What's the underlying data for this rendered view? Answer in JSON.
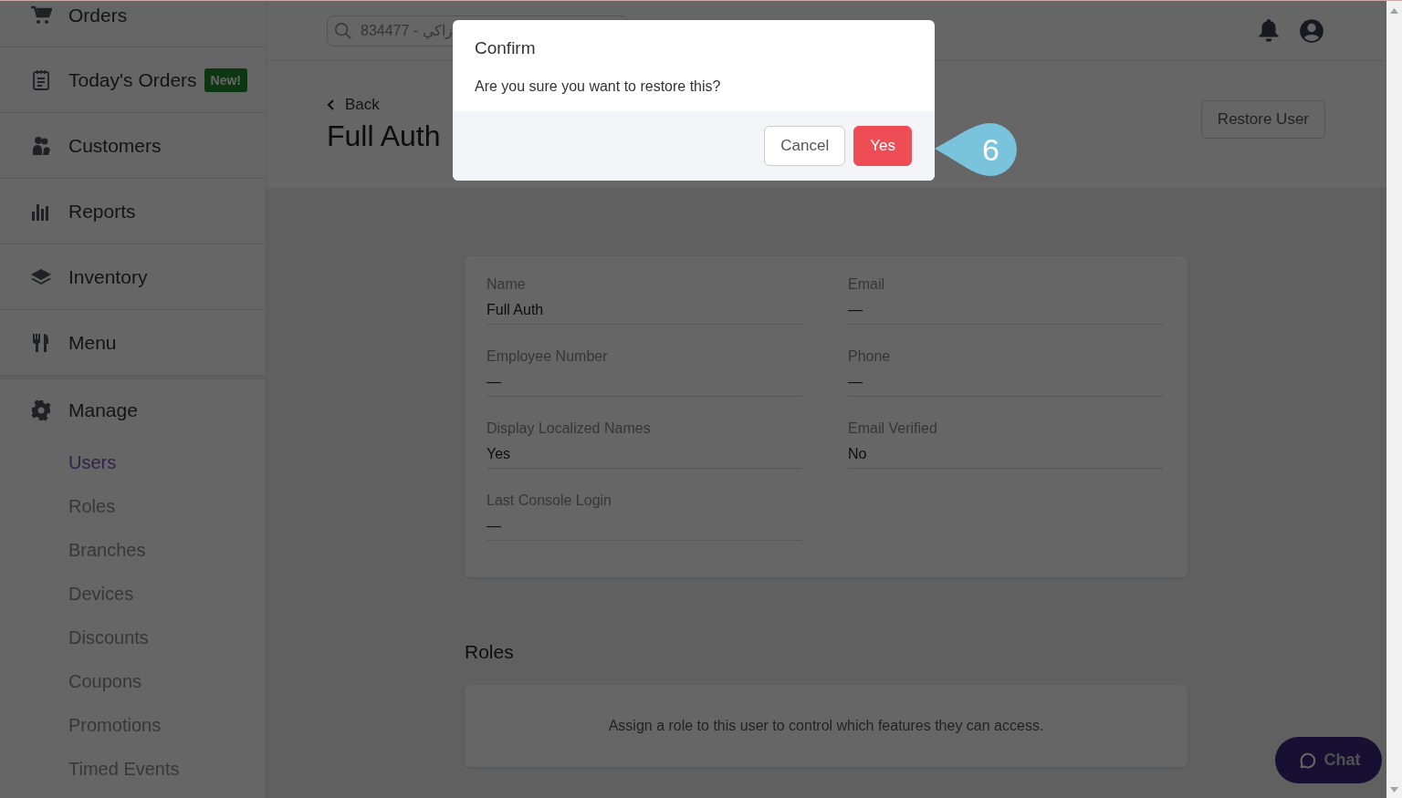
{
  "sidebar": {
    "items": [
      {
        "label": "Orders"
      },
      {
        "label": "Today's Orders",
        "badge": "New!"
      },
      {
        "label": "Customers"
      },
      {
        "label": "Reports"
      },
      {
        "label": "Inventory"
      },
      {
        "label": "Menu"
      },
      {
        "label": "Manage",
        "children": [
          {
            "label": "Users",
            "selected": true
          },
          {
            "label": "Roles",
            "selected": false
          },
          {
            "label": "Branches",
            "selected": false
          },
          {
            "label": "Devices",
            "selected": false
          },
          {
            "label": "Discounts",
            "selected": false
          },
          {
            "label": "Coupons",
            "selected": false
          },
          {
            "label": "Promotions",
            "selected": false
          },
          {
            "label": "Timed Events",
            "selected": false
          }
        ]
      }
    ]
  },
  "header": {
    "search": {
      "value": "834477 - زاكي"
    }
  },
  "page": {
    "back": "Back",
    "title": "Full Auth",
    "action": "Restore User"
  },
  "details": {
    "fields": [
      {
        "label": "Name",
        "value": "Full Auth"
      },
      {
        "label": "Email",
        "value": "—"
      },
      {
        "label": "Employee Number",
        "value": "—"
      },
      {
        "label": "Phone",
        "value": "—"
      },
      {
        "label": "Display Localized Names",
        "value": "Yes"
      },
      {
        "label": "Email Verified",
        "value": "No"
      },
      {
        "label": "Last Console Login",
        "value": "—"
      }
    ]
  },
  "roles": {
    "heading": "Roles",
    "empty_text": "Assign a role to this user to control which features they can access."
  },
  "chat": {
    "label": "Chat"
  },
  "modal": {
    "title": "Confirm",
    "message": "Are you sure you want to restore this?",
    "buttons": [
      {
        "label": "Cancel",
        "kind": "secondary"
      },
      {
        "label": "Yes",
        "kind": "primary"
      }
    ]
  },
  "annotation": {
    "label": "6"
  }
}
